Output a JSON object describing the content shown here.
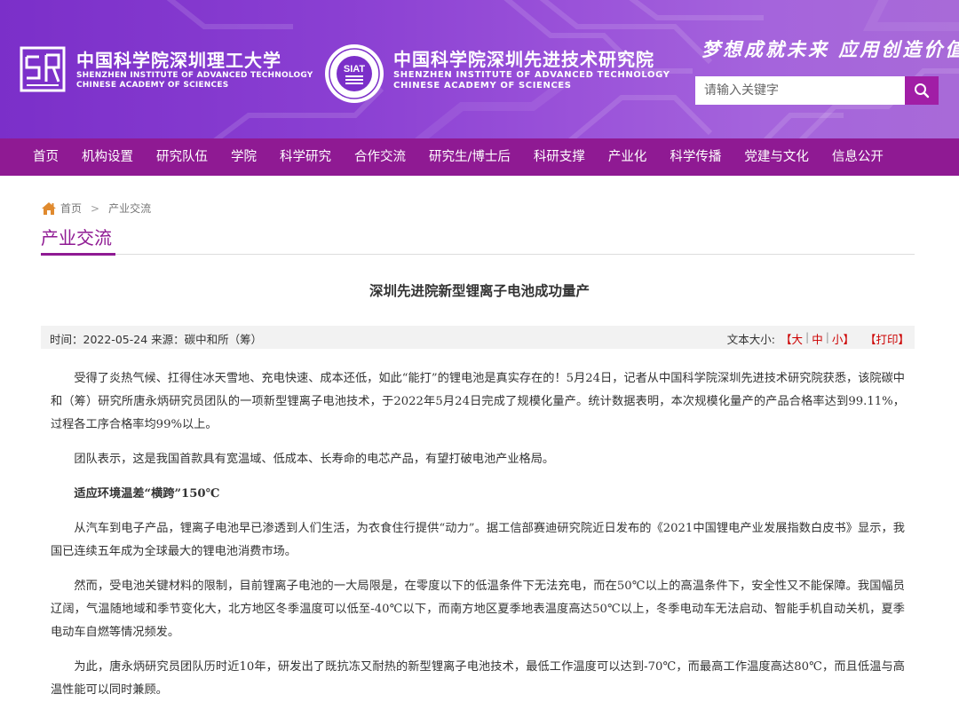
{
  "header": {
    "org1": {
      "cn": "中国科学院深圳理工大学",
      "en1": "SHENZHEN INSTITUTE OF ADVANCED TECHNOLOGY",
      "en2": "CHINESE ACADEMY OF SCIENCES"
    },
    "org2": {
      "cn": "中国科学院深圳先进技术研究院",
      "en1": "SHENZHEN INSTITUTE OF ADVANCED TECHNOLOGY",
      "en2": "CHINESE ACADEMY OF SCIENCES",
      "logo_text": "SIAT"
    },
    "slogan": "梦想成就未来  应用创造价值",
    "search": {
      "placeholder": "请输入关键字"
    }
  },
  "colors": {
    "header_gradient_start": "#7b2fc9",
    "header_gradient_end": "#a86ad8",
    "nav_bg": "#8f1a93",
    "accent": "#8f1a93",
    "search_button": "#a11ea6",
    "meta_red": "#cc0000"
  },
  "nav": {
    "items": [
      "首页",
      "机构设置",
      "研究队伍",
      "学院",
      "科学研究",
      "合作交流",
      "研究生/博士后",
      "科研支撑",
      "产业化",
      "科学传播",
      "党建与文化",
      "信息公开"
    ]
  },
  "breadcrumb": {
    "home": "首页",
    "separator": ">",
    "current": "产业交流"
  },
  "section": {
    "title": "产业交流"
  },
  "article": {
    "title": "深圳先进院新型锂离子电池成功量产",
    "meta": {
      "info": "时间：2022-05-24  来源：碳中和所（筹）",
      "font_size_label": "文本大小:",
      "size_large": "大",
      "size_medium": "中",
      "size_small": "小",
      "print": "打印"
    },
    "paragraphs": [
      "受得了炎热气候、扛得住冰天雪地、充电快速、成本还低，如此“能打”的锂电池是真实存在的！5月24日，记者从中国科学院深圳先进技术研究院获悉，该院碳中和（筹）研究所唐永炳研究员团队的一项新型锂离子电池技术，于2022年5月24日完成了规模化量产。统计数据表明，本次规模化量产的产品合格率达到99.11%，过程各工序合格率均99%以上。",
      "团队表示，这是我国首款具有宽温域、低成本、长寿命的电芯产品，有望打破电池产业格局。",
      "适应环境温差“横跨”150℃",
      "从汽车到电子产品，锂离子电池早已渗透到人们生活，为衣食住行提供“动力”。据工信部赛迪研究院近日发布的《2021中国锂电产业发展指数白皮书》显示，我国已连续五年成为全球最大的锂电池消费市场。",
      "然而，受电池关键材料的限制，目前锂离子电池的一大局限是，在零度以下的低温条件下无法充电，而在50℃以上的高温条件下，安全性又不能保障。我国幅员辽阔，气温随地域和季节变化大，北方地区冬季温度可以低至-40℃以下，而南方地区夏季地表温度高达50℃以上，冬季电动车无法启动、智能手机自动关机，夏季电动车自燃等情况频发。",
      "为此，唐永炳研究员团队历时近10年，研发出了既抗冻又耐热的新型锂离子电池技术，最低工作温度可以达到-70℃，而最高工作温度高达80℃，而且低温与高温性能可以同时兼顾。"
    ]
  }
}
